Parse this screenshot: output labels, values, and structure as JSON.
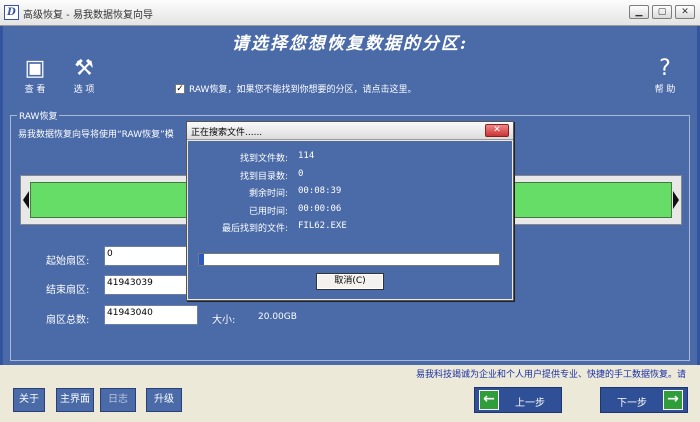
{
  "window": {
    "title": "高级恢复 - 易我数据恢复向导",
    "icon_letter": "D"
  },
  "heading": "请选择您想恢复数据的分区:",
  "toolbar": {
    "view_label": "查 看",
    "options_label": "选 项",
    "help_label": "帮 助"
  },
  "raw_option": {
    "checked": true,
    "label": "RAW恢复，如果您不能找到你想要的分区，请点击这里。"
  },
  "group": {
    "title": "RAW恢复",
    "description": "易我数据恢复向导将使用“RAW恢复”模"
  },
  "fields": {
    "start_sector_label": "起始扇区:",
    "start_sector_value": "0",
    "end_sector_label": "结束扇区:",
    "end_sector_value": "41943039",
    "total_sectors_label": "扇区总数:",
    "total_sectors_value": "41943040",
    "size_label": "大小:",
    "size_value": "20.00GB"
  },
  "slogan": "易我科技竭诚为企业和个人用户提供专业、快捷的手工数据恢复。请",
  "buttons": {
    "about": "关于",
    "home": "主界面",
    "log": "日志",
    "upgrade": "升级",
    "prev": "上一步",
    "next": "下一步"
  },
  "dialog": {
    "title": "正在搜索文件......",
    "close": "✕",
    "files_found_label": "找到文件数:",
    "files_found_value": "114",
    "dirs_found_label": "找到目录数:",
    "dirs_found_value": "0",
    "remaining_label": "剩余时间:",
    "remaining_value": "00:08:39",
    "elapsed_label": "已用时间:",
    "elapsed_value": "00:00:06",
    "last_file_label": "最后找到的文件:",
    "last_file_value": "FIL62.EXE",
    "cancel": "取消(C)",
    "progress_percent": 1.5
  }
}
